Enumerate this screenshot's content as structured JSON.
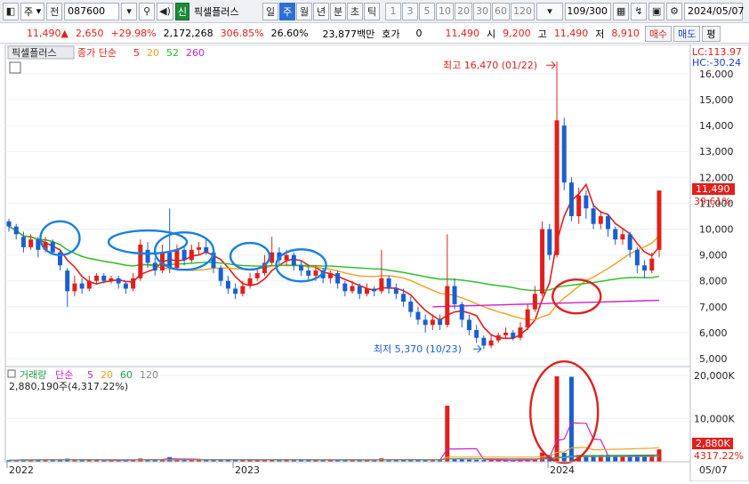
{
  "toolbar": {
    "market_label": "주",
    "prefix_label": "전",
    "code": "087600",
    "green_tag": "신",
    "stock_name": "픽셀플러스",
    "period_tabs": [
      "일",
      "주",
      "월",
      "년",
      "분",
      "초",
      "틱"
    ],
    "active_period": "주",
    "interval_buttons": [
      "1",
      "3",
      "5",
      "10",
      "20",
      "30",
      "60",
      "120"
    ],
    "bar_count": "109/300",
    "date": "2024/05/07"
  },
  "quote": {
    "price": "11,490",
    "change": "2,650",
    "change_pct": "+29.98%",
    "volume": "2,172,268",
    "volume_ratio": "306.85%",
    "turnover": "26.60%",
    "amount": "23,877백만",
    "hoga_label": "호가",
    "hoga_value": "0",
    "ask": "11,490",
    "open_label": "시",
    "open": "9,200",
    "high_label": "고",
    "high": "11,490",
    "low_label": "저",
    "low": "8,910",
    "buy_label": "매수",
    "sell_label": "매도",
    "eval_label": "평"
  },
  "price_panel": {
    "name_tag": "픽셀플러스",
    "ma_label": "종가 단순",
    "ma_periods": [
      "5",
      "20",
      "52",
      "260"
    ],
    "ma_colors": [
      "#e0201c",
      "#f0a020",
      "#22c022",
      "#d020c0"
    ],
    "lc": "LC:113.97",
    "hc": "HC:-30.24",
    "y_ticks": [
      "16,000",
      "15,000",
      "14,000",
      "13,000",
      "12,000",
      "11,000",
      "10,000",
      "9,000",
      "8,000",
      "7,000",
      "6,000",
      "5,000"
    ],
    "high_annotation": "최고 16,470 (01/22)",
    "low_annotation": "최저 5,370 (10/23)",
    "current_price_tag": "11,490",
    "current_pct_tag": "39.61%"
  },
  "volume_panel": {
    "title": "거래량",
    "ma_label": "단순",
    "ma_periods": [
      "5",
      "20",
      "60",
      "120"
    ],
    "ma_colors": [
      "#d020c0",
      "#f0a020",
      "#22a040",
      "#888888"
    ],
    "current_line": "2,880,190주(4,317.22%)",
    "y_ticks": [
      "20,000K",
      "10,000K"
    ],
    "current_tag": "2,880K",
    "current_pct": "4317.22%"
  },
  "x_axis": {
    "labels": [
      "2022",
      "2023",
      "2024"
    ],
    "end_date": "05/07"
  },
  "colors": {
    "up": "#e0201c",
    "down": "#1a5fd0",
    "highlight_circle_blue": "#1a7fe0",
    "highlight_circle_red": "#e0201c"
  },
  "chart_data": {
    "type": "candlestick",
    "period": "weekly",
    "price_range": [
      5000,
      16470
    ],
    "candles": [
      {
        "o": 10300,
        "c": 10100,
        "h": 10400,
        "l": 9900
      },
      {
        "o": 10100,
        "c": 9800,
        "h": 10200,
        "l": 9600
      },
      {
        "o": 9700,
        "c": 9300,
        "h": 9900,
        "l": 9100
      },
      {
        "o": 9300,
        "c": 9600,
        "h": 9800,
        "l": 9200
      },
      {
        "o": 9600,
        "c": 9200,
        "h": 9700,
        "l": 8900
      },
      {
        "o": 9200,
        "c": 9500,
        "h": 9700,
        "l": 9100
      },
      {
        "o": 9500,
        "c": 9100,
        "h": 9600,
        "l": 9000
      },
      {
        "o": 9100,
        "c": 8600,
        "h": 9200,
        "l": 8400
      },
      {
        "o": 8400,
        "c": 7600,
        "h": 8500,
        "l": 7000
      },
      {
        "o": 7600,
        "c": 7900,
        "h": 8200,
        "l": 7400
      },
      {
        "o": 7900,
        "c": 7700,
        "h": 8100,
        "l": 7500
      },
      {
        "o": 7700,
        "c": 8000,
        "h": 8200,
        "l": 7600
      },
      {
        "o": 8000,
        "c": 8200,
        "h": 8300,
        "l": 7900
      },
      {
        "o": 8200,
        "c": 8000,
        "h": 8300,
        "l": 7900
      },
      {
        "o": 8000,
        "c": 8100,
        "h": 8200,
        "l": 7900
      },
      {
        "o": 8100,
        "c": 7900,
        "h": 8200,
        "l": 7700
      },
      {
        "o": 7900,
        "c": 7700,
        "h": 8000,
        "l": 7500
      },
      {
        "o": 7700,
        "c": 8100,
        "h": 8300,
        "l": 7600
      },
      {
        "o": 8100,
        "c": 9400,
        "h": 9600,
        "l": 8000
      },
      {
        "o": 9200,
        "c": 8700,
        "h": 9500,
        "l": 8500
      },
      {
        "o": 8700,
        "c": 8400,
        "h": 8900,
        "l": 8200
      },
      {
        "o": 8400,
        "c": 9100,
        "h": 9400,
        "l": 8300
      },
      {
        "o": 9100,
        "c": 8500,
        "h": 10800,
        "l": 8300
      },
      {
        "o": 8500,
        "c": 9200,
        "h": 9400,
        "l": 8400
      },
      {
        "o": 9200,
        "c": 8800,
        "h": 9300,
        "l": 8600
      },
      {
        "o": 8800,
        "c": 9200,
        "h": 9400,
        "l": 8700
      },
      {
        "o": 9200,
        "c": 9300,
        "h": 9500,
        "l": 9000
      },
      {
        "o": 9300,
        "c": 9100,
        "h": 9600,
        "l": 9000
      },
      {
        "o": 9100,
        "c": 8500,
        "h": 9200,
        "l": 8300
      },
      {
        "o": 8500,
        "c": 8000,
        "h": 8600,
        "l": 7800
      },
      {
        "o": 8000,
        "c": 7700,
        "h": 8200,
        "l": 7500
      },
      {
        "o": 7700,
        "c": 7500,
        "h": 7900,
        "l": 7300
      },
      {
        "o": 7500,
        "c": 7800,
        "h": 8000,
        "l": 7400
      },
      {
        "o": 7800,
        "c": 8100,
        "h": 8300,
        "l": 7700
      },
      {
        "o": 8100,
        "c": 8300,
        "h": 8500,
        "l": 8000
      },
      {
        "o": 8300,
        "c": 8700,
        "h": 9000,
        "l": 8200
      },
      {
        "o": 8700,
        "c": 9100,
        "h": 9700,
        "l": 8600
      },
      {
        "o": 9100,
        "c": 8800,
        "h": 9300,
        "l": 8600
      },
      {
        "o": 8800,
        "c": 9000,
        "h": 9200,
        "l": 8600
      },
      {
        "o": 9000,
        "c": 8600,
        "h": 9100,
        "l": 8400
      },
      {
        "o": 8600,
        "c": 8400,
        "h": 8800,
        "l": 8200
      },
      {
        "o": 8400,
        "c": 8200,
        "h": 8600,
        "l": 8000
      },
      {
        "o": 8200,
        "c": 8400,
        "h": 8600,
        "l": 8000
      },
      {
        "o": 8400,
        "c": 8100,
        "h": 8500,
        "l": 7900
      },
      {
        "o": 8100,
        "c": 8300,
        "h": 8400,
        "l": 7900
      },
      {
        "o": 8300,
        "c": 7900,
        "h": 8400,
        "l": 7700
      },
      {
        "o": 7900,
        "c": 7600,
        "h": 8000,
        "l": 7400
      },
      {
        "o": 7600,
        "c": 7800,
        "h": 8000,
        "l": 7500
      },
      {
        "o": 7800,
        "c": 7500,
        "h": 7900,
        "l": 7300
      },
      {
        "o": 7500,
        "c": 7700,
        "h": 7900,
        "l": 7400
      },
      {
        "o": 7700,
        "c": 7600,
        "h": 7800,
        "l": 7400
      },
      {
        "o": 7600,
        "c": 8100,
        "h": 9200,
        "l": 7500
      },
      {
        "o": 8100,
        "c": 7700,
        "h": 8200,
        "l": 7500
      },
      {
        "o": 7700,
        "c": 7500,
        "h": 7900,
        "l": 7300
      },
      {
        "o": 7500,
        "c": 7200,
        "h": 7700,
        "l": 7000
      },
      {
        "o": 7200,
        "c": 6800,
        "h": 7400,
        "l": 6600
      },
      {
        "o": 6800,
        "c": 6500,
        "h": 7000,
        "l": 6300
      },
      {
        "o": 6500,
        "c": 6300,
        "h": 6700,
        "l": 6000
      },
      {
        "o": 6300,
        "c": 6500,
        "h": 6700,
        "l": 6100
      },
      {
        "o": 6500,
        "c": 6300,
        "h": 6700,
        "l": 6100
      },
      {
        "o": 6300,
        "c": 7800,
        "h": 9800,
        "l": 6200
      },
      {
        "o": 7800,
        "c": 7100,
        "h": 8100,
        "l": 6900
      },
      {
        "o": 7100,
        "c": 6500,
        "h": 7200,
        "l": 6200
      },
      {
        "o": 6500,
        "c": 6100,
        "h": 6700,
        "l": 5900
      },
      {
        "o": 6100,
        "c": 5800,
        "h": 6300,
        "l": 5600
      },
      {
        "o": 5800,
        "c": 5500,
        "h": 5900,
        "l": 5370
      },
      {
        "o": 5500,
        "c": 5700,
        "h": 5900,
        "l": 5400
      },
      {
        "o": 5700,
        "c": 5900,
        "h": 6000,
        "l": 5600
      },
      {
        "o": 5900,
        "c": 6000,
        "h": 6200,
        "l": 5800
      },
      {
        "o": 6000,
        "c": 5800,
        "h": 6100,
        "l": 5700
      },
      {
        "o": 5800,
        "c": 6200,
        "h": 6400,
        "l": 5700
      },
      {
        "o": 6200,
        "c": 6900,
        "h": 7100,
        "l": 6100
      },
      {
        "o": 6900,
        "c": 7500,
        "h": 7800,
        "l": 6800
      },
      {
        "o": 7500,
        "c": 10000,
        "h": 10300,
        "l": 7400
      },
      {
        "o": 10000,
        "c": 9000,
        "h": 10200,
        "l": 8800
      },
      {
        "o": 9000,
        "c": 14200,
        "h": 16470,
        "l": 8900
      },
      {
        "o": 14000,
        "c": 11800,
        "h": 14300,
        "l": 11500
      },
      {
        "o": 11800,
        "c": 10500,
        "h": 12000,
        "l": 10300
      },
      {
        "o": 10500,
        "c": 11300,
        "h": 11600,
        "l": 10200
      },
      {
        "o": 11300,
        "c": 10800,
        "h": 11500,
        "l": 10400
      },
      {
        "o": 10800,
        "c": 10200,
        "h": 11000,
        "l": 10000
      },
      {
        "o": 10200,
        "c": 10500,
        "h": 10700,
        "l": 10000
      },
      {
        "o": 10500,
        "c": 10000,
        "h": 10600,
        "l": 9700
      },
      {
        "o": 10000,
        "c": 9600,
        "h": 10100,
        "l": 9400
      },
      {
        "o": 9600,
        "c": 9800,
        "h": 10000,
        "l": 9400
      },
      {
        "o": 9800,
        "c": 9200,
        "h": 9900,
        "l": 8900
      },
      {
        "o": 9200,
        "c": 8600,
        "h": 9300,
        "l": 8300
      },
      {
        "o": 8600,
        "c": 8400,
        "h": 8800,
        "l": 8100
      },
      {
        "o": 8400,
        "c": 8860,
        "h": 9100,
        "l": 8300
      },
      {
        "o": 9200,
        "c": 11490,
        "h": 11490,
        "l": 8910
      }
    ],
    "volume_highlight_weeks": [
      60,
      75,
      77,
      90
    ],
    "volume_spikes": {
      "60": 13000,
      "75": 19800,
      "77": 19700
    }
  }
}
